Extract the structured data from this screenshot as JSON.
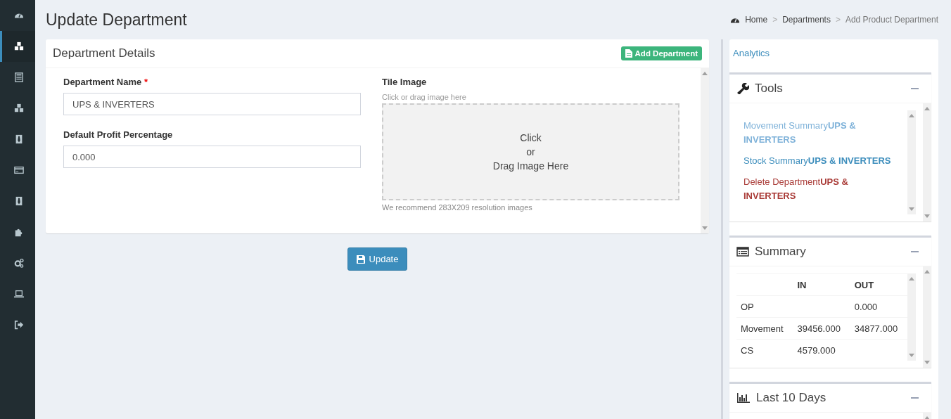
{
  "sidebar": {
    "items": [
      {
        "selected": false
      },
      {
        "selected": true
      },
      {
        "selected": false
      },
      {
        "selected": false
      },
      {
        "selected": false
      },
      {
        "selected": false
      },
      {
        "selected": false
      },
      {
        "selected": false
      },
      {
        "selected": false
      },
      {
        "selected": false
      },
      {
        "selected": false
      }
    ]
  },
  "page_title": "Update Department",
  "breadcrumb": {
    "items": [
      "Home",
      "Departments",
      "Add Product Department"
    ],
    "separator": ">"
  },
  "details_card": {
    "title": "Department Details",
    "add_button": "Add Department",
    "fields": [
      {
        "label": "Department Name",
        "required_mark": "*",
        "value": "UPS & INVERTERS"
      },
      {
        "label": "Default Profit Percentage",
        "value": "0.000"
      }
    ],
    "tile_image": {
      "label": "Tile Image",
      "hint": "Click or drag image here",
      "drop_text": [
        "Click",
        "or",
        "Drag Image Here"
      ],
      "note": "We recommend 283X209 resolution images"
    }
  },
  "update_button": "Update",
  "analytics": {
    "title": "Analytics",
    "tools": {
      "title": "Tools",
      "links": [
        {
          "text": "Movement Summary**UPS & INVERTERS**",
          "color": "#7fb2d9"
        },
        {
          "text": "Stock Summary**UPS & INVERTERS**",
          "color": "#3c8dbc"
        },
        {
          "text": "Delete Department**UPS & INVERTERS**",
          "color": "#a93a36"
        }
      ]
    },
    "summary": {
      "title": "Summary",
      "columns": [
        "IN",
        "OUT"
      ],
      "rows": [
        {
          "label": "OP",
          "out": "0.000"
        },
        {
          "label": "Movement",
          "in": "39456.000",
          "out": "34877.000"
        },
        {
          "label": "CS",
          "in": "4579.000"
        }
      ]
    },
    "last_days": {
      "title": "Last 10 Days"
    }
  }
}
